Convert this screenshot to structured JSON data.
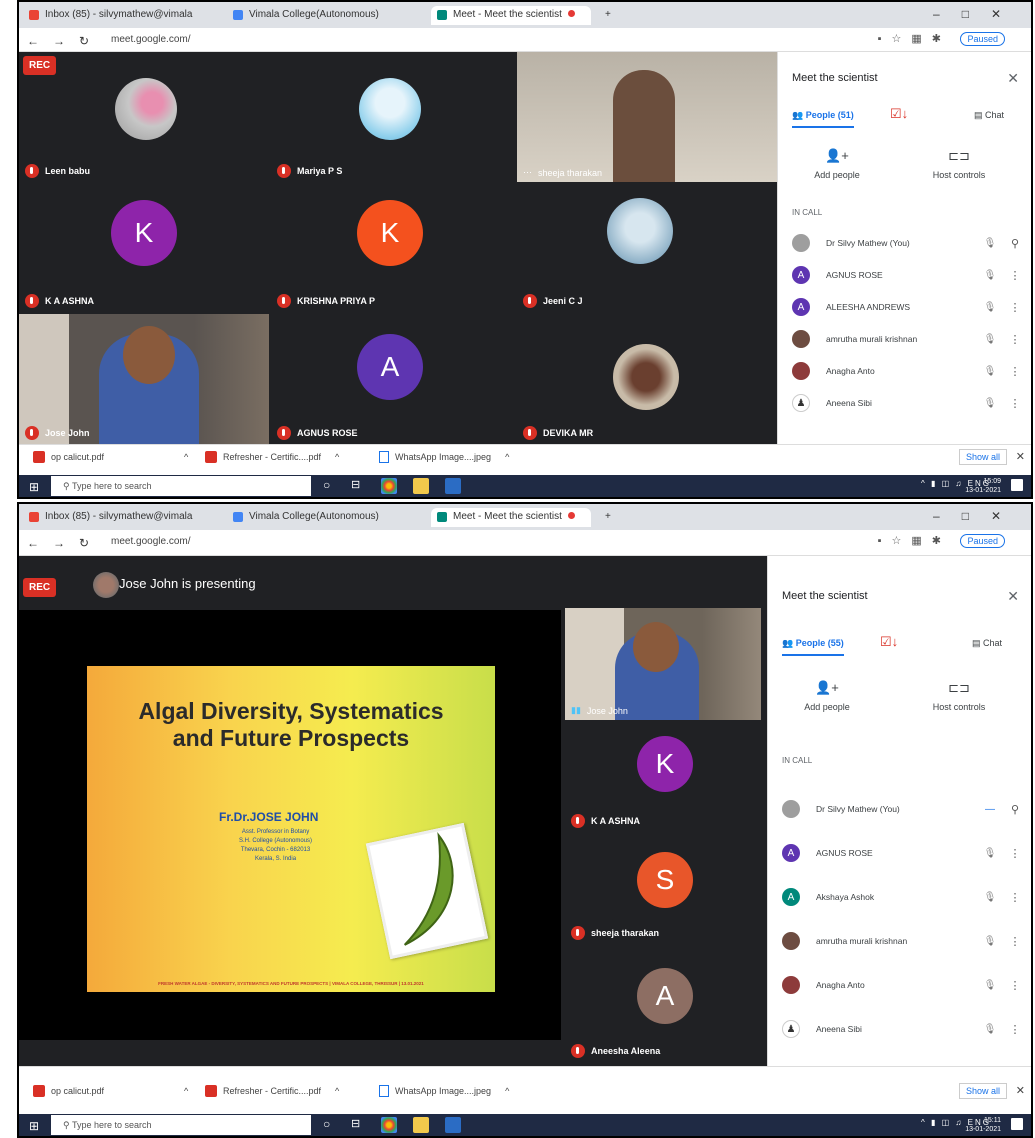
{
  "browser": {
    "tabs": [
      {
        "label": "Inbox (85) - silvymathew@vimala",
        "color": "#ea4335"
      },
      {
        "label": "Vimala College(Autonomous)",
        "color": "#4285f4"
      },
      {
        "label": "Meet - Meet the scientist",
        "color": "#00897b"
      }
    ],
    "url1": "meet.google.com/",
    "url2": "meet.google.com/",
    "profile": "Paused",
    "icon_names": [
      "back-icon",
      "forward-icon",
      "reload-icon",
      "star-icon",
      "extensions-icon"
    ]
  },
  "meet1": {
    "rec": "REC",
    "tiles": [
      {
        "name": "Leen babu"
      },
      {
        "name": "Mariya P S"
      },
      {
        "name": "sheeja tharakan"
      },
      {
        "name": "K A ASHNA",
        "initial": "K",
        "color": "#8e24aa"
      },
      {
        "name": "KRISHNA PRIYA P",
        "initial": "K",
        "color": "#f4511e"
      },
      {
        "name": "Jeeni C J"
      },
      {
        "name": "Jose John"
      },
      {
        "name": "AGNUS ROSE",
        "initial": "A",
        "color": "#5e35b1"
      },
      {
        "name": "DEVIKA MR"
      }
    ]
  },
  "panel1": {
    "title": "Meet the scientist",
    "people_tab": "People (51)",
    "chat_tab": "Chat",
    "add_people": "Add people",
    "host_controls": "Host controls",
    "in_call": "IN CALL",
    "people": [
      {
        "name": "Dr Silvy Mathew (You)",
        "initial": "",
        "color": "#9e9e9e"
      },
      {
        "name": "AGNUS ROSE",
        "initial": "A",
        "color": "#5e35b1"
      },
      {
        "name": "ALEESHA ANDREWS",
        "initial": "A",
        "color": "#5e35b1"
      },
      {
        "name": "amrutha murali krishnan",
        "initial": "",
        "color": "#6d4c41"
      },
      {
        "name": "Anagha Anto",
        "initial": "",
        "color": "#8d3b3b"
      },
      {
        "name": "Aneena Sibi",
        "initial": "",
        "color": "#ffffff"
      }
    ]
  },
  "downloads": {
    "items": [
      "op calicut.pdf",
      "Refresher - Certific....pdf",
      "WhatsApp Image....jpeg"
    ],
    "show_all": "Show all"
  },
  "taskbar": {
    "search": "Type here to search",
    "lang": "ENG",
    "time1": "15:09",
    "date1": "13-01-2021",
    "time2": "15:11",
    "date2": "13-01-2021"
  },
  "meet2": {
    "rec": "REC",
    "presenting": "Jose John is presenting",
    "slide": {
      "title_line1": "Algal Diversity, Systematics",
      "title_line2": "and Future Prospects",
      "presenter": "Fr.Dr.JOSE JOHN",
      "aff1": "Asst. Professor in Botany",
      "aff2": "S.H. College (Autonomous)",
      "aff3": "Thevara, Cochin - 682013",
      "aff4": "Kerala, S. India",
      "footer": "FRESH WATER ALGAE - DIVERSITY, SYSTEMATICS AND FUTURE PROSPECTS | VIMALA COLLEGE, THRISSUR | 13.01.2021"
    },
    "tiles": [
      {
        "name": "Jose John"
      },
      {
        "name": "K A ASHNA",
        "initial": "K",
        "color": "#8e24aa"
      },
      {
        "name": "sheeja tharakan",
        "initial": "S",
        "color": "#e8562a"
      },
      {
        "name": "Aneesha Aleena",
        "initial": "A",
        "color": "#8d6e63"
      }
    ]
  },
  "panel2": {
    "title": "Meet the scientist",
    "people_tab": "People (55)",
    "chat_tab": "Chat",
    "add_people": "Add people",
    "host_controls": "Host controls",
    "in_call": "IN CALL",
    "people": [
      {
        "name": "Dr Silvy Mathew (You)",
        "initial": "",
        "color": "#9e9e9e"
      },
      {
        "name": "AGNUS ROSE",
        "initial": "A",
        "color": "#5e35b1"
      },
      {
        "name": "Akshaya Ashok",
        "initial": "A",
        "color": "#00897b"
      },
      {
        "name": "amrutha murali krishnan",
        "initial": "",
        "color": "#6d4c41"
      },
      {
        "name": "Anagha Anto",
        "initial": "",
        "color": "#8d3b3b"
      },
      {
        "name": "Aneena Sibi",
        "initial": "",
        "color": "#ffffff"
      }
    ]
  }
}
